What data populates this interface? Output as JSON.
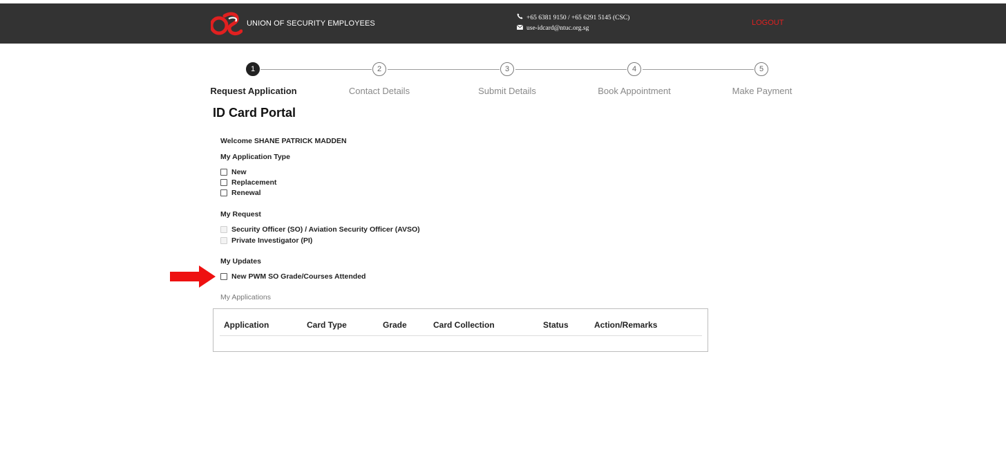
{
  "header": {
    "org_name": "UNION OF SECURITY EMPLOYEES",
    "phone": "+65 6381 9150 / +65 6291 5145 (CSC)",
    "email": "use-idcard@ntuc.org.sg",
    "logout_label": "LOGOUT",
    "logo_icon": "use-logo-icon",
    "phone_icon": "phone-icon",
    "mail_icon": "envelope-icon",
    "bar_color": "#333333",
    "logout_color": "#e02020"
  },
  "steps": [
    {
      "number": "1",
      "label": "Request Application",
      "active": true
    },
    {
      "number": "2",
      "label": "Contact Details",
      "active": false
    },
    {
      "number": "3",
      "label": "Submit Details",
      "active": false
    },
    {
      "number": "4",
      "label": "Book Appointment",
      "active": false
    },
    {
      "number": "5",
      "label": "Make Payment",
      "active": false
    }
  ],
  "page": {
    "title": "ID Card Portal",
    "welcome": "Welcome SHANE PATRICK MADDEN"
  },
  "application_type": {
    "heading": "My Application Type",
    "options": [
      "New",
      "Replacement",
      "Renewal"
    ]
  },
  "request": {
    "heading": "My Request",
    "options": [
      "Security Officer (SO) / Aviation Security Officer (AVSO)",
      "Private Investigator (PI)"
    ]
  },
  "updates": {
    "heading": "My Updates",
    "options": [
      "New PWM SO Grade/Courses Attended"
    ]
  },
  "applications": {
    "heading": "My Applications",
    "columns": [
      "Application",
      "Card Type",
      "Grade",
      "Card Collection",
      "Status",
      "Action/Remarks"
    ]
  },
  "annotation": {
    "arrow_icon": "red-arrow-icon",
    "arrow_color": "#ee1111"
  }
}
